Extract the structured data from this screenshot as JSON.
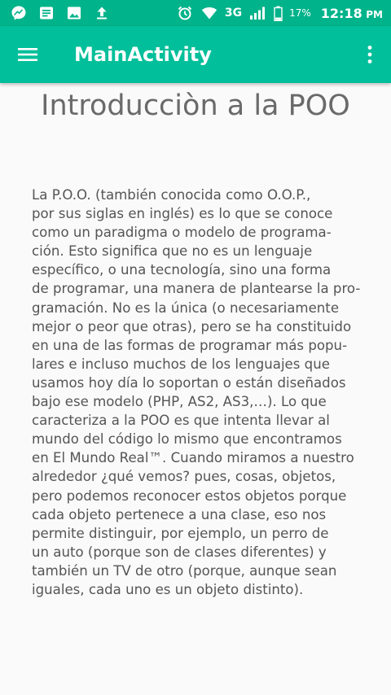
{
  "status_bar": {
    "icons_left": [
      "messenger-icon",
      "notes-icon",
      "image-icon",
      "upload-icon"
    ],
    "network": "3G",
    "battery": "17%",
    "time": "12:18",
    "ampm": "PM"
  },
  "app_bar": {
    "title": "MainActivity",
    "menu_icon": "hamburger-menu-icon",
    "overflow_icon": "overflow-menu-icon"
  },
  "content": {
    "heading": "Introducciòn  a la POO",
    "body": " La P.O.O. (también conocida como O.O.P.,\npor sus siglas en inglés) es lo que se conoce\ncomo un paradigma o modelo de programa-\nción. Esto significa que no es un lenguaje\nespecífico, o una tecnología, sino una forma\nde programar, una manera de plantearse la pro-\ngramación. No es la única (o necesariamente\nmejor o peor que otras), pero se ha constituido\nen una de las formas de programar más popu-\nlares e incluso muchos de los lenguajes que\nusamos hoy día lo soportan o están diseñados\nbajo ese modelo (PHP, AS2, AS3,…). Lo que\ncaracteriza a la POO es que intenta llevar al\nmundo del código lo mismo que encontramos\nen El Mundo Real™. Cuando miramos a nuestro\nalrededor ¿qué vemos? pues, cosas, objetos,\npero podemos reconocer estos objetos porque\ncada objeto pertenece a una clase, eso nos\npermite distinguir, por ejemplo, un perro de\nun auto (porque son de clases diferentes) y\ntambién un TV de otro (porque, aunque sean\niguales, cada uno es un objeto distinto)."
  },
  "colors": {
    "status_bar": "#00b38a",
    "app_bar": "#00bf9a",
    "background": "#fafafa",
    "heading_text": "#6a6a6a",
    "body_text": "#555555"
  }
}
